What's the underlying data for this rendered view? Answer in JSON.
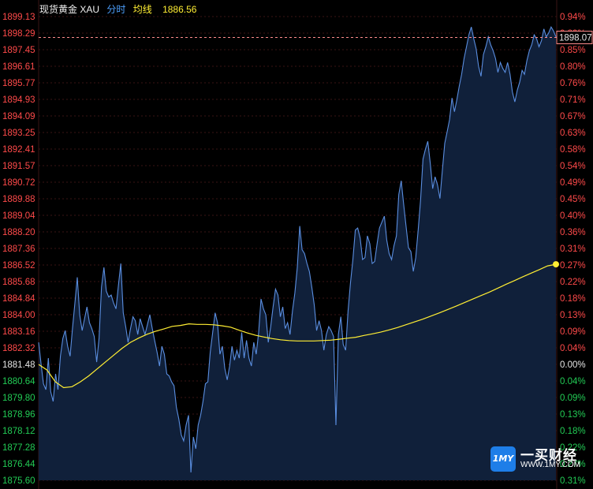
{
  "header": {
    "instrument": "现货黄金 XAU",
    "mode": "分时",
    "avg_label": "均线",
    "avg_value": "1886.56"
  },
  "logo": {
    "name": "一买财经",
    "url": "WWW.1MY.COM",
    "badge": "1MY"
  },
  "colors": {
    "background": "#000000",
    "grid": "#3a1414",
    "axis_up": "#ff4a4a",
    "axis_down": "#22cc55",
    "axis_flat": "#e6e6e6",
    "price_line": "#5a8ee0",
    "area_fill": "#10203a",
    "avg_line": "#ffee33",
    "last_price_line": "#ff8c8c",
    "header_text": "#f0f0f0",
    "header_mode": "#4ea1ff",
    "header_avg": "#ffee33"
  },
  "chart_data": {
    "type": "line",
    "ylim": [
      1875.6,
      1899.13
    ],
    "reference_price": 1881.48,
    "price_ticks": [
      "1899.13",
      "1898.29",
      "1897.45",
      "1896.61",
      "1895.77",
      "1894.93",
      "1894.09",
      "1893.25",
      "1892.41",
      "1891.57",
      "1890.72",
      "1889.88",
      "1889.04",
      "1888.20",
      "1887.36",
      "1886.52",
      "1885.68",
      "1884.84",
      "1884.00",
      "1883.16",
      "1882.32",
      "1881.48",
      "1880.64",
      "1879.80",
      "1878.96",
      "1878.12",
      "1877.28",
      "1876.44",
      "1875.60"
    ],
    "percent_ticks": [
      "0.94%",
      "0.89%",
      "0.85%",
      "0.80%",
      "0.76%",
      "0.71%",
      "0.67%",
      "0.63%",
      "0.58%",
      "0.54%",
      "0.49%",
      "0.45%",
      "0.40%",
      "0.36%",
      "0.31%",
      "0.27%",
      "0.22%",
      "0.18%",
      "0.13%",
      "0.09%",
      "0.04%",
      "0.00%",
      "0.04%",
      "0.09%",
      "0.13%",
      "0.18%",
      "0.22%",
      "0.27%",
      "0.31%"
    ],
    "last_price": "1898.07",
    "series": [
      {
        "values": [
          1882.6,
          1881.5,
          1880.5,
          1880.2,
          1881.8,
          1880.1,
          1879.6,
          1881.0,
          1880.2,
          1881.9,
          1882.8,
          1883.2,
          1882.4,
          1881.9,
          1883.3,
          1884.6,
          1885.9,
          1884.0,
          1883.2,
          1883.8,
          1884.4,
          1883.6,
          1883.3,
          1882.9,
          1881.6,
          1882.8,
          1885.4,
          1886.4,
          1885.2,
          1884.9,
          1885.0,
          1884.6,
          1884.3,
          1885.5,
          1886.6,
          1884.1,
          1883.4,
          1882.6,
          1883.3,
          1883.9,
          1883.7,
          1883.0,
          1883.8,
          1883.4,
          1883.0,
          1883.5,
          1884.0,
          1883.3,
          1882.7,
          1882.1,
          1881.4,
          1882.4,
          1882.0,
          1881.0,
          1880.9,
          1880.6,
          1880.4,
          1879.3,
          1878.7,
          1877.9,
          1877.6,
          1878.4,
          1878.9,
          1876.0,
          1877.8,
          1877.2,
          1878.4,
          1878.9,
          1879.6,
          1880.5,
          1880.6,
          1882.1,
          1883.1,
          1884.1,
          1883.6,
          1882.0,
          1882.4,
          1881.3,
          1880.7,
          1881.4,
          1882.4,
          1881.7,
          1882.2,
          1881.8,
          1883.1,
          1881.8,
          1882.7,
          1881.8,
          1881.4,
          1882.6,
          1882.0,
          1883.1,
          1884.8,
          1884.3,
          1884.0,
          1882.6,
          1883.4,
          1884.4,
          1885.3,
          1885.0,
          1883.9,
          1884.4,
          1883.3,
          1883.6,
          1883.0,
          1884.2,
          1885.1,
          1886.4,
          1888.5,
          1887.3,
          1887.1,
          1886.6,
          1886.2,
          1885.4,
          1884.5,
          1883.2,
          1883.7,
          1883.2,
          1882.2,
          1883.0,
          1883.4,
          1883.2,
          1882.9,
          1878.4,
          1883.0,
          1883.9,
          1882.5,
          1882.2,
          1884.2,
          1885.6,
          1886.8,
          1888.3,
          1888.4,
          1887.9,
          1886.8,
          1886.9,
          1888.0,
          1887.6,
          1886.6,
          1886.7,
          1887.6,
          1888.4,
          1888.7,
          1889.0,
          1887.8,
          1887.1,
          1886.8,
          1887.5,
          1888.0,
          1890.1,
          1890.8,
          1889.6,
          1888.5,
          1887.4,
          1887.2,
          1886.2,
          1886.9,
          1888.3,
          1889.8,
          1891.9,
          1892.4,
          1892.8,
          1891.7,
          1890.4,
          1891.0,
          1890.6,
          1889.9,
          1891.3,
          1892.7,
          1893.3,
          1893.9,
          1895.0,
          1894.3,
          1894.9,
          1895.6,
          1896.2,
          1897.0,
          1897.6,
          1898.2,
          1898.6,
          1898.0,
          1897.5,
          1896.6,
          1896.1,
          1897.2,
          1897.6,
          1898.1,
          1897.7,
          1897.4,
          1897.0,
          1896.3,
          1896.8,
          1896.5,
          1896.3,
          1896.8,
          1896.2,
          1895.3,
          1894.8,
          1895.4,
          1895.8,
          1896.4,
          1896.2,
          1896.9,
          1897.4,
          1897.7,
          1898.2,
          1898.0,
          1897.6,
          1897.9,
          1898.5,
          1898.1,
          1898.3,
          1898.6,
          1898.4,
          1898.1
        ],
        "avg": [
          1881.48,
          1881.2,
          1880.6,
          1880.3,
          1880.35,
          1880.6,
          1880.9,
          1881.25,
          1881.6,
          1881.95,
          1882.3,
          1882.6,
          1882.82,
          1883.01,
          1883.16,
          1883.28,
          1883.41,
          1883.46,
          1883.54,
          1883.51,
          1883.51,
          1883.49,
          1883.44,
          1883.37,
          1883.22,
          1883.08,
          1882.96,
          1882.87,
          1882.79,
          1882.73,
          1882.69,
          1882.67,
          1882.67,
          1882.67,
          1882.69,
          1882.71,
          1882.76,
          1882.81,
          1882.86,
          1882.95,
          1883.03,
          1883.12,
          1883.23,
          1883.35,
          1883.49,
          1883.63,
          1883.77,
          1883.93,
          1884.09,
          1884.26,
          1884.43,
          1884.61,
          1884.79,
          1884.97,
          1885.15,
          1885.34,
          1885.54,
          1885.73,
          1885.92,
          1886.11,
          1886.29,
          1886.48,
          1886.56
        ]
      }
    ]
  }
}
